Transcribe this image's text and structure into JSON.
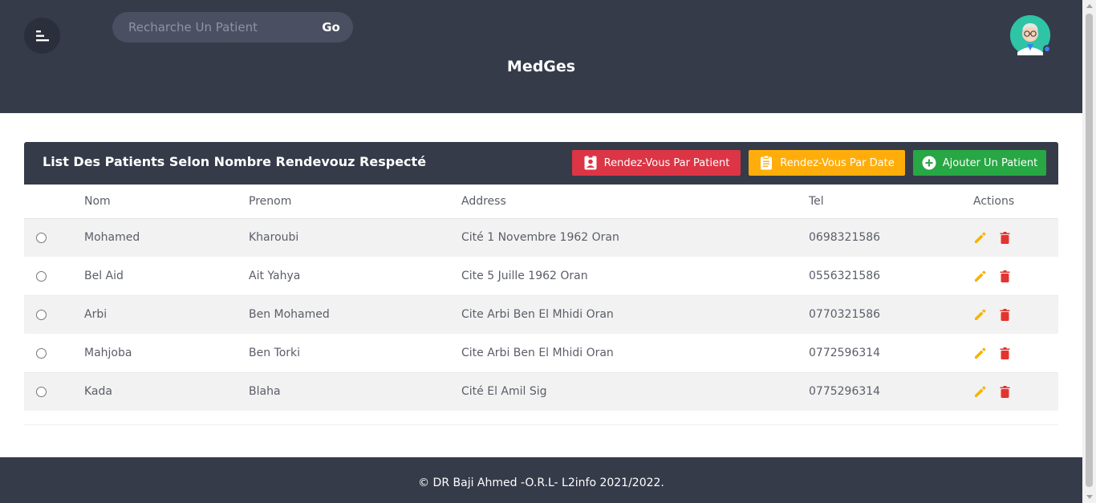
{
  "header": {
    "search_placeholder": "Recharche Un Patient",
    "search_button": "Go",
    "brand": "MedGes"
  },
  "card": {
    "title": "List Des Patients Selon Nombre Rendevouz Respecté",
    "buttons": {
      "by_patient": "Rendez-Vous Par Patient",
      "by_date": "Rendez-Vous Par Date",
      "add_patient": "Ajouter Un Patient"
    }
  },
  "table": {
    "columns": [
      "",
      "Nom",
      "Prenom",
      "Address",
      "Tel",
      "Actions"
    ],
    "rows": [
      {
        "nom": "Mohamed",
        "prenom": "Kharoubi",
        "address": "Cité 1 Novembre 1962 Oran",
        "tel": "0698321586"
      },
      {
        "nom": "Bel Aid",
        "prenom": "Ait Yahya",
        "address": "Cite 5 Juille 1962 Oran",
        "tel": "0556321586"
      },
      {
        "nom": "Arbi",
        "prenom": "Ben Mohamed",
        "address": "Cite Arbi Ben El Mhidi Oran",
        "tel": "0770321586"
      },
      {
        "nom": "Mahjoba",
        "prenom": "Ben Torki",
        "address": "Cite Arbi Ben El Mhidi Oran",
        "tel": "0772596314"
      },
      {
        "nom": "Kada",
        "prenom": "Blaha",
        "address": "Cité El Amil Sig",
        "tel": "0775296314"
      }
    ]
  },
  "footer": {
    "text": "© DR Baji Ahmed -O.R.L- L2info 2021/2022."
  },
  "colors": {
    "header_bg": "#363b4a",
    "danger": "#dc3545",
    "warning": "#ffad0a",
    "success": "#28a745",
    "edit_icon": "#f5b400",
    "delete_icon": "#e3342f"
  },
  "icons": {
    "menu": "menu-icon",
    "avatar": "doctor-avatar-icon",
    "by_patient": "user-badge-icon",
    "by_date": "clipboard-icon",
    "add": "plus-circle-icon",
    "edit": "pencil-icon",
    "delete": "trash-icon"
  }
}
